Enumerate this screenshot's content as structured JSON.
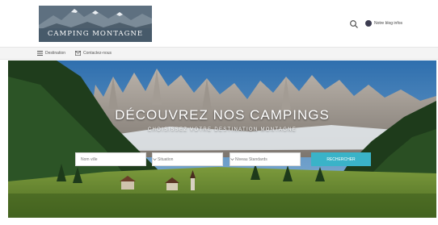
{
  "logo": {
    "text": "CAMPING MONTAGNE"
  },
  "header": {
    "account_label": "Notre blog infos"
  },
  "nav": {
    "items": [
      {
        "label": "Destination"
      },
      {
        "label": "Contactez-nous"
      }
    ]
  },
  "hero": {
    "title": "DÉCOUVREZ NOS CAMPINGS",
    "subtitle": "CHOISISSEZ VOTRE DESTINATION MONTAGNE"
  },
  "search_form": {
    "field1_placeholder": "Nom ville",
    "field2_value": "Situation",
    "field3_value": "Niveau Standards",
    "submit_label": "RECHERCHER"
  },
  "colors": {
    "accent": "#3ab3c8",
    "logo_bg": "#5e7080"
  }
}
